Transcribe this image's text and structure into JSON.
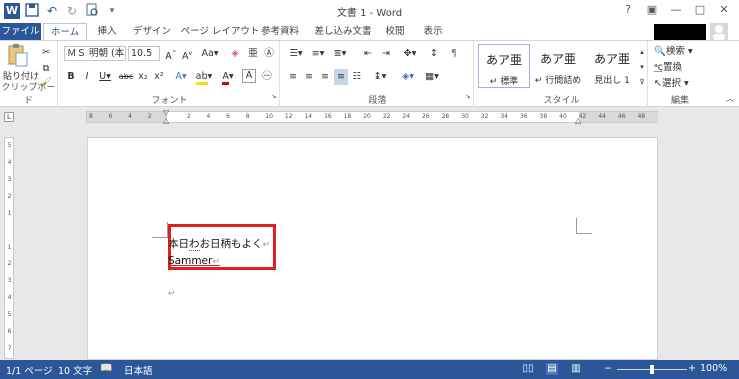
{
  "window": {
    "title": "文書 1 - Word",
    "help": "?",
    "ribbon_display": "▣",
    "minimize": "—",
    "maximize": "□",
    "close": "✕"
  },
  "qat": {
    "app_icon": "W",
    "save": "💾",
    "undo": "↶",
    "redo": "↻",
    "print_preview": "🔍",
    "customize": "▾"
  },
  "tabs": [
    {
      "label": "ファイル"
    },
    {
      "label": "ホーム"
    },
    {
      "label": "挿入"
    },
    {
      "label": "デザイン"
    },
    {
      "label": "ページ レイアウト"
    },
    {
      "label": "参考資料"
    },
    {
      "label": "差し込み文書"
    },
    {
      "label": "校閲"
    },
    {
      "label": "表示"
    }
  ],
  "ribbon": {
    "clipboard": {
      "label": "クリップボード",
      "paste": "貼り付け"
    },
    "font": {
      "label": "フォント",
      "name": "ＭＳ 明朝 (本",
      "size": "10.5"
    },
    "paragraph": {
      "label": "段落"
    },
    "styles": {
      "label": "スタイル",
      "items": [
        {
          "preview": "あア亜",
          "name": "↵ 標準"
        },
        {
          "preview": "あア亜",
          "name": "↵ 行間詰め"
        },
        {
          "preview": "あア亜",
          "name": "見出し 1"
        }
      ]
    },
    "editing": {
      "label": "編集",
      "find": "検索",
      "replace": "置換",
      "select": "選択"
    }
  },
  "ruler": {
    "ticks": [
      "8",
      "6",
      "4",
      "2",
      "",
      "2",
      "4",
      "6",
      "8",
      "10",
      "12",
      "14",
      "16",
      "18",
      "20",
      "22",
      "24",
      "26",
      "28",
      "30",
      "32",
      "34",
      "36",
      "38",
      "40",
      "42",
      "44",
      "46",
      "48"
    ]
  },
  "vruler": {
    "ticks": [
      "5",
      "4",
      "3",
      "2",
      "1",
      "",
      "1",
      "2",
      "3",
      "4",
      "5",
      "6",
      "7"
    ]
  },
  "document": {
    "line1": "本日わお日柄もよく",
    "line1_prefix": "本日",
    "line1_squig": "わ",
    "line1_suffix": "お日柄もよく",
    "line2": "Sammer",
    "para_mark": "↵"
  },
  "statusbar": {
    "page": "1/1 ページ",
    "words": "10 文字",
    "language": "日本語",
    "zoom": "100%",
    "zoom_level": 1.0
  },
  "colors": {
    "accent": "#2b579a",
    "highlight_box": "#e02020"
  }
}
